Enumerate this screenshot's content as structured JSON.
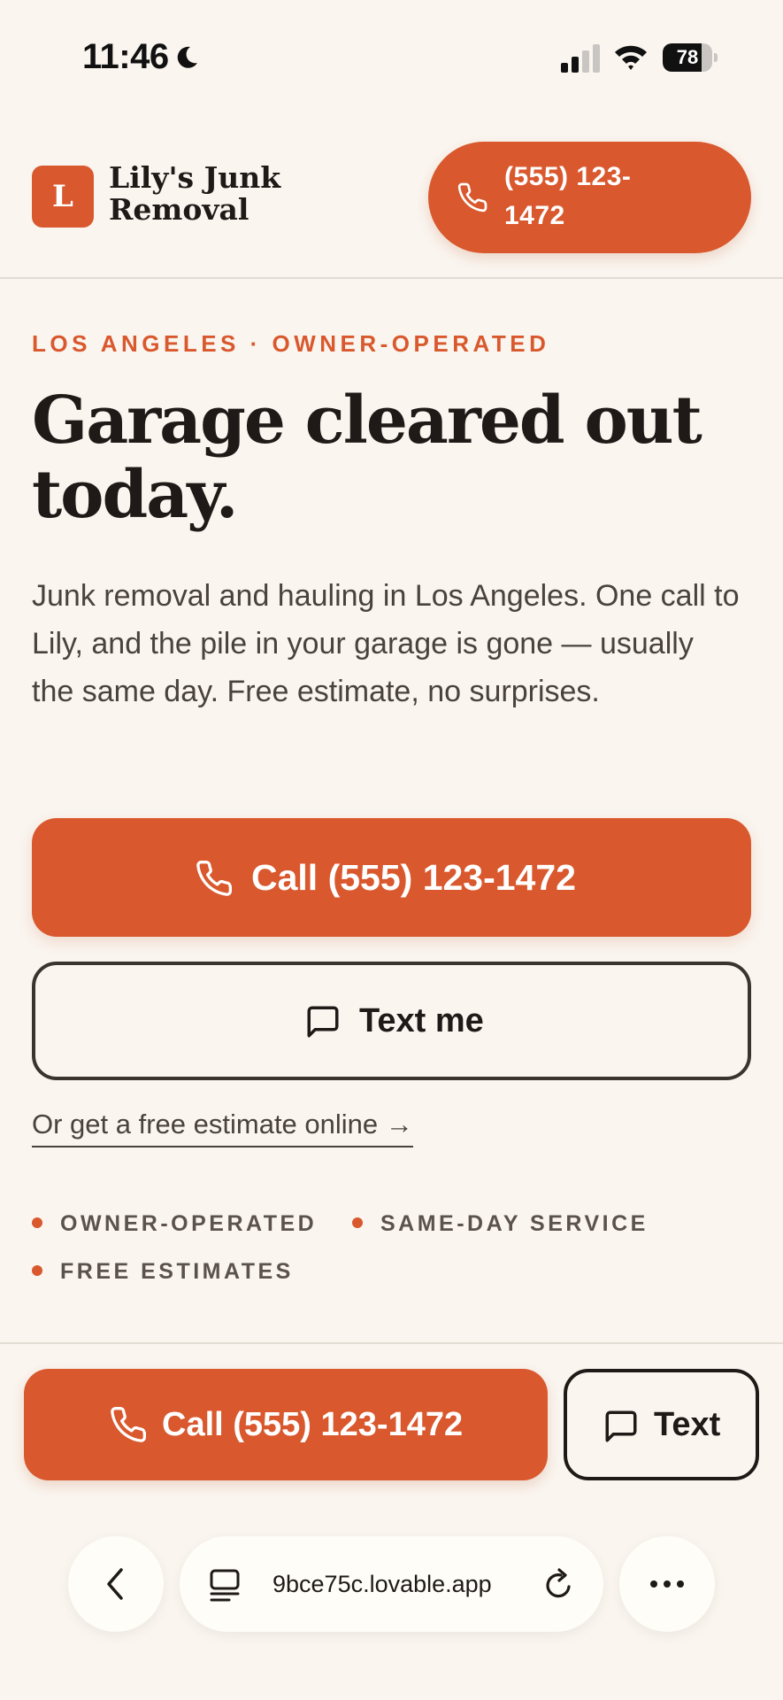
{
  "status_bar": {
    "time": "11:46",
    "battery": "78",
    "battery_level": 0.78
  },
  "header": {
    "logo_letter": "L",
    "brand_name": "Lily's Junk Removal",
    "call_label": "(555) 123-1472"
  },
  "hero": {
    "eyebrow": "LOS ANGELES · OWNER-OPERATED",
    "headline": "Garage cleared out today.",
    "lede": "Junk removal and hauling in Los Angeles. One call to Lily, and the pile in your garage is gone — usually the same day. Free estimate, no surprises.",
    "primary_call": "Call (555) 123-1472",
    "text_me": "Text me",
    "estimate_link": "Or get a free estimate online →",
    "features": [
      "OWNER-OPERATED",
      "SAME-DAY SERVICE",
      "FREE ESTIMATES"
    ]
  },
  "sticky_bar": {
    "call_label": "Call (555) 123-1472",
    "text_label": "Text"
  },
  "browser": {
    "url": "9bce75c.lovable.app"
  },
  "colors": {
    "accent": "#d9582d",
    "background": "#faf5ef",
    "ink": "#1f1a17"
  },
  "icons": [
    "moon-icon",
    "cellular-signal-icon",
    "wifi-icon",
    "battery-icon",
    "phone-icon",
    "chat-bubble-icon",
    "chevron-left-icon",
    "tabs-icon",
    "reload-icon",
    "more-icon"
  ]
}
